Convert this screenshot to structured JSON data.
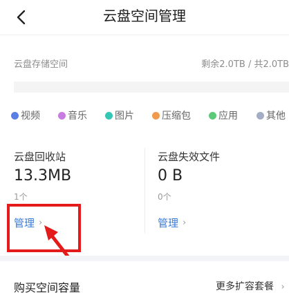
{
  "header": {
    "title": "云盘空间管理",
    "back_icon": "chevron-left-icon"
  },
  "storage": {
    "label": "云盘存储空间",
    "summary": "剩余2.0TB / 共2.0TB"
  },
  "legend": [
    {
      "label": "视频",
      "color": "#5b7ee5"
    },
    {
      "label": "音乐",
      "color": "#c77ce0"
    },
    {
      "label": "图片",
      "color": "#35c7b5"
    },
    {
      "label": "压缩包",
      "color": "#f29a4b"
    },
    {
      "label": "应用",
      "color": "#5cc979"
    },
    {
      "label": "其他",
      "color": "#a3aec4"
    }
  ],
  "recycle": {
    "title": "云盘回收站",
    "size": "13.3MB",
    "count": "1个",
    "manage_label": "管理"
  },
  "invalid": {
    "title": "云盘失效文件",
    "size": "0 B",
    "count": "0个",
    "manage_label": "管理"
  },
  "purchase": {
    "title": "购买空间容量",
    "more_label": "更多扩容套餐"
  },
  "colors": {
    "link": "#3a7bd5",
    "annotation": "#e31b1b"
  }
}
